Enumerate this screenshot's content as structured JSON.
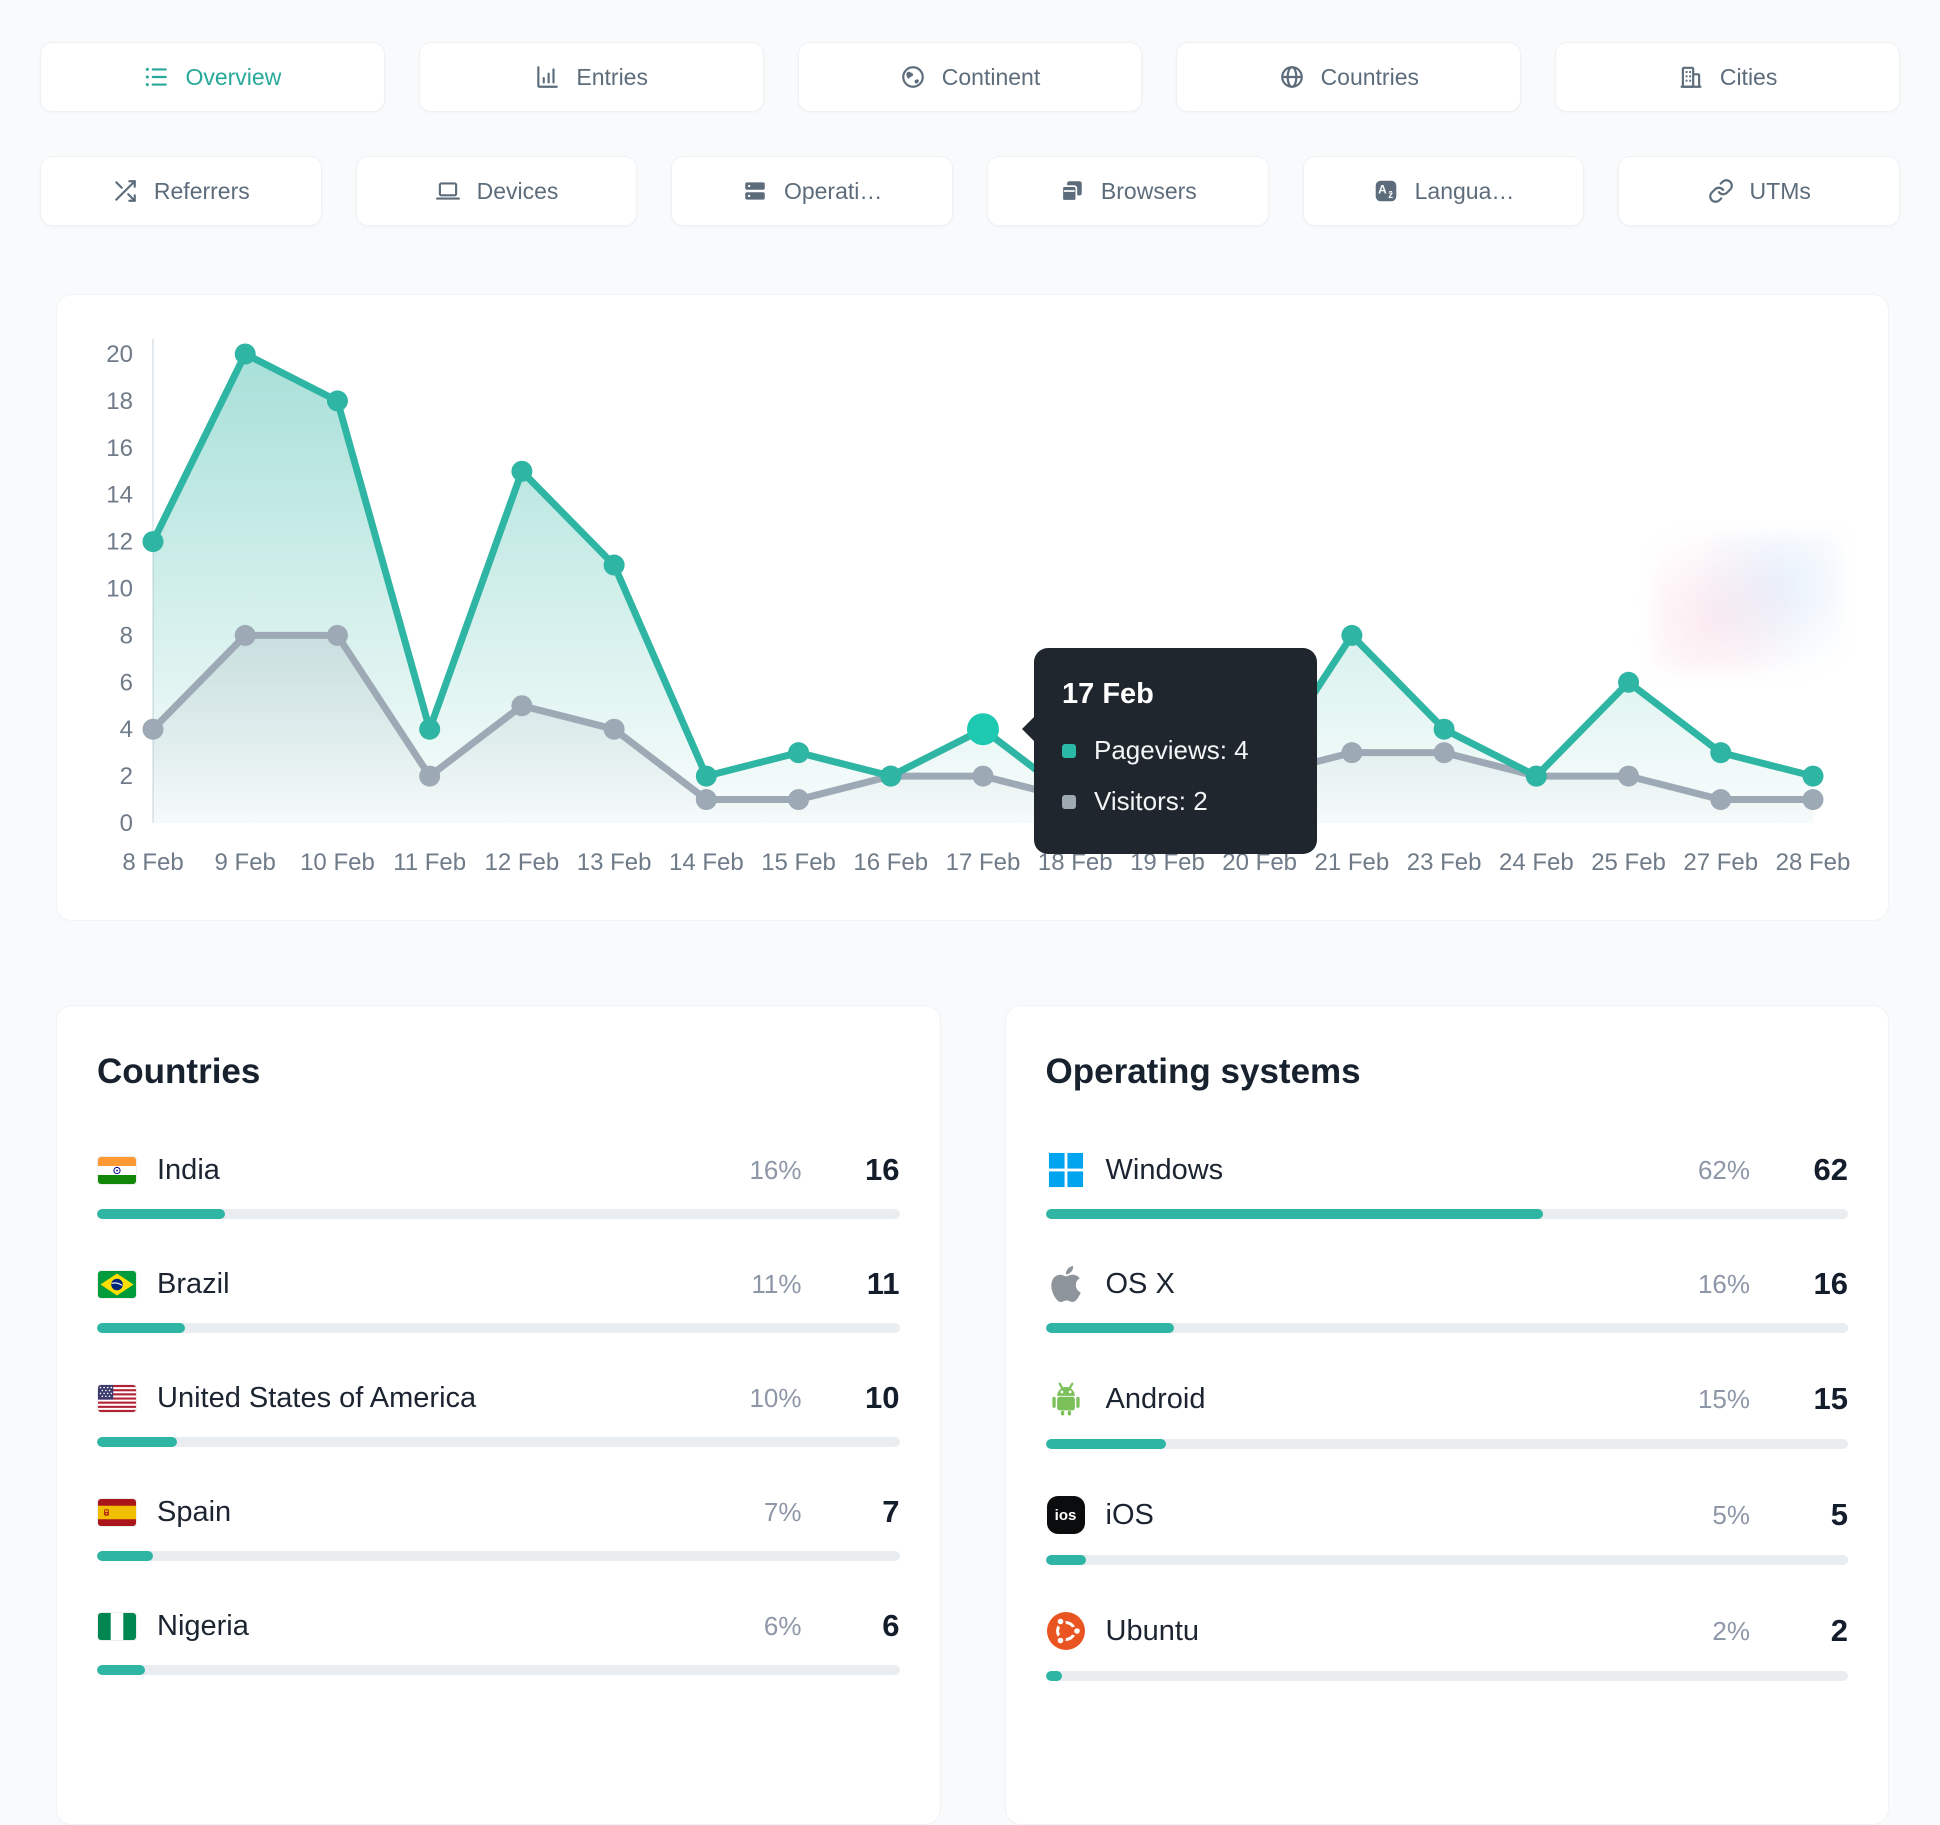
{
  "colors": {
    "accent": "#2fb5a3",
    "accent_highlight": "#1dc9b1",
    "secondary_line": "#9daab5",
    "tab_text": "#5d6c7b",
    "tab_active_text": "#27a898",
    "heading_text": "#18212e",
    "muted_text": "#8d97a7",
    "value_text": "#141d2b",
    "axis_text": "#6f7b88",
    "bar_track": "#e9edf0",
    "tooltip_bg": "#20262e",
    "windows_blue": "#00a4ef",
    "apple_gray": "#8d949c",
    "android_green": "#7cc05a",
    "ubuntu_orange": "#e95420"
  },
  "tabs": {
    "row1": [
      {
        "label": "Overview",
        "icon": "list-icon",
        "active": true
      },
      {
        "label": "Entries",
        "icon": "bar-chart-icon",
        "active": false
      },
      {
        "label": "Continent",
        "icon": "globe-americas-icon",
        "active": false
      },
      {
        "label": "Countries",
        "icon": "globe-icon",
        "active": false
      },
      {
        "label": "Cities",
        "icon": "buildings-icon",
        "active": false
      }
    ],
    "row2": [
      {
        "label": "Referrers",
        "icon": "shuffle-icon"
      },
      {
        "label": "Devices",
        "icon": "laptop-icon"
      },
      {
        "label": "Operati…",
        "icon": "server-icon"
      },
      {
        "label": "Browsers",
        "icon": "browser-windows-icon"
      },
      {
        "label": "Langua…",
        "icon": "translate-icon"
      },
      {
        "label": "UTMs",
        "icon": "link-icon"
      }
    ]
  },
  "chart_data": {
    "type": "line",
    "x": [
      "8 Feb",
      "9 Feb",
      "10 Feb",
      "11 Feb",
      "12 Feb",
      "13 Feb",
      "14 Feb",
      "15 Feb",
      "16 Feb",
      "17 Feb",
      "18 Feb",
      "19 Feb",
      "20 Feb",
      "21 Feb",
      "23 Feb",
      "24 Feb",
      "25 Feb",
      "27 Feb",
      "28 Feb"
    ],
    "series": [
      {
        "name": "Pageviews",
        "color": "#2fb5a3",
        "values": [
          12,
          20,
          18,
          4,
          15,
          11,
          2,
          3,
          2,
          4,
          1,
          1,
          2,
          8,
          4,
          2,
          6,
          3,
          2
        ]
      },
      {
        "name": "Visitors",
        "color": "#9daab5",
        "values": [
          4,
          8,
          8,
          2,
          5,
          4,
          1,
          1,
          2,
          2,
          1,
          1,
          2,
          3,
          3,
          2,
          2,
          1,
          1
        ]
      }
    ],
    "ylim": [
      0,
      20
    ],
    "yticks": [
      0,
      2,
      4,
      6,
      8,
      10,
      12,
      14,
      16,
      18,
      20
    ],
    "grid": false,
    "legend": "none",
    "highlight_index": 9,
    "highlight_color": "#1dc9b1"
  },
  "tooltip": {
    "title": "17 Feb",
    "rows": [
      {
        "text": "Pageviews: 4",
        "swatch_color": "#2bb9a7",
        "swatch_inner": "#cdeee8"
      },
      {
        "text": "Visitors: 2",
        "swatch_color": "#9fa9b2",
        "swatch_inner": "#eceff1"
      }
    ]
  },
  "panels": [
    {
      "title": "Countries",
      "rows": [
        {
          "label": "India",
          "icon": "india-flag-icon",
          "percent": "16%",
          "value": "16",
          "bar": 16
        },
        {
          "label": "Brazil",
          "icon": "brazil-flag-icon",
          "percent": "11%",
          "value": "11",
          "bar": 11
        },
        {
          "label": "United States of America",
          "icon": "usa-flag-icon",
          "percent": "10%",
          "value": "10",
          "bar": 10
        },
        {
          "label": "Spain",
          "icon": "spain-flag-icon",
          "percent": "7%",
          "value": "7",
          "bar": 7
        },
        {
          "label": "Nigeria",
          "icon": "nigeria-flag-icon",
          "percent": "6%",
          "value": "6",
          "bar": 6
        }
      ]
    },
    {
      "title": "Operating systems",
      "rows": [
        {
          "label": "Windows",
          "icon": "windows-icon",
          "percent": "62%",
          "value": "62",
          "bar": 62
        },
        {
          "label": "OS X",
          "icon": "apple-icon",
          "percent": "16%",
          "value": "16",
          "bar": 16
        },
        {
          "label": "Android",
          "icon": "android-icon",
          "percent": "15%",
          "value": "15",
          "bar": 15
        },
        {
          "label": "iOS",
          "icon": "ios-icon",
          "percent": "5%",
          "value": "5",
          "bar": 5,
          "badge": "ios"
        },
        {
          "label": "Ubuntu",
          "icon": "ubuntu-icon",
          "percent": "2%",
          "value": "2",
          "bar": 2
        }
      ]
    }
  ]
}
